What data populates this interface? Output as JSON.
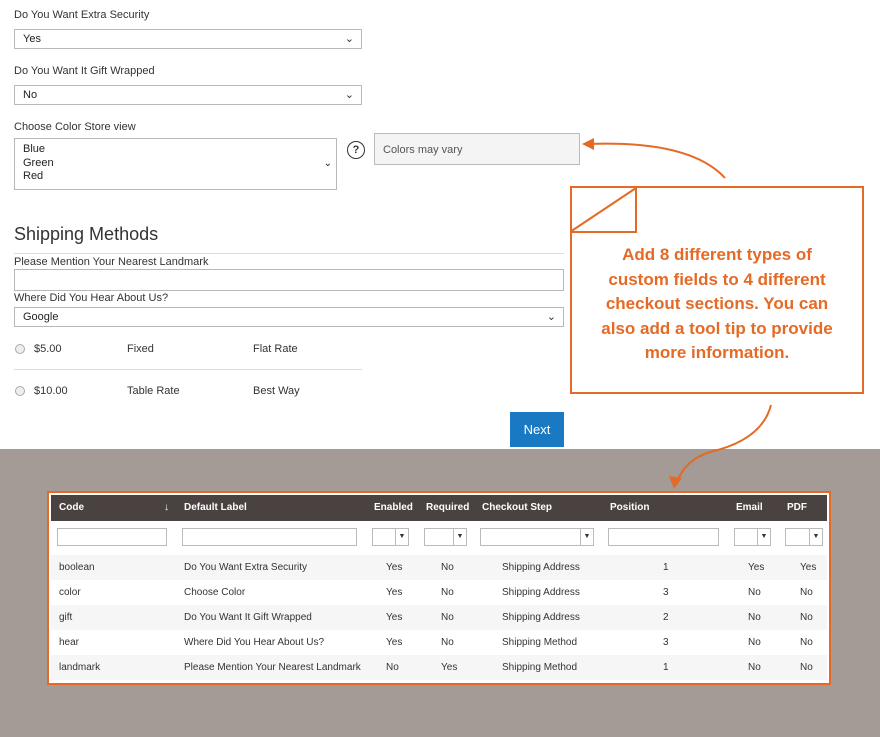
{
  "form": {
    "extra_security": {
      "label": "Do You Want Extra Security",
      "value": "Yes"
    },
    "gift_wrapped": {
      "label": "Do You Want It Gift Wrapped",
      "value": "No"
    },
    "color_store": {
      "label": "Choose Color Store view",
      "options": [
        "Blue",
        "Green",
        "Red"
      ],
      "help": "?",
      "tooltip": "Colors may vary"
    }
  },
  "shipping": {
    "title": "Shipping Methods",
    "landmark_label": "Please Mention Your Nearest Landmark",
    "landmark_value": "",
    "hear_label": "Where Did You Hear About Us?",
    "hear_value": "Google",
    "methods": [
      {
        "price": "$5.00",
        "type": "Fixed",
        "name": "Flat Rate"
      },
      {
        "price": "$10.00",
        "type": "Table Rate",
        "name": "Best Way"
      }
    ],
    "next_label": "Next"
  },
  "callout": {
    "lines": [
      "Add 8 different types of",
      "custom fields to 4 different",
      "checkout sections. You can",
      "also add a tool tip to provide",
      "more information."
    ],
    "color": "#e46a25"
  },
  "grid": {
    "columns": [
      "Code",
      "Default Label",
      "Enabled",
      "Required",
      "Checkout Step",
      "Position",
      "Email",
      "PDF"
    ],
    "sort_indicator": "↓",
    "rows": [
      [
        "boolean",
        "Do You Want Extra Security",
        "Yes",
        "No",
        "Shipping Address",
        "1",
        "Yes",
        "Yes"
      ],
      [
        "color",
        "Choose Color",
        "Yes",
        "No",
        "Shipping Address",
        "3",
        "No",
        "No"
      ],
      [
        "gift",
        "Do You Want It Gift Wrapped",
        "Yes",
        "No",
        "Shipping Address",
        "2",
        "No",
        "No"
      ],
      [
        "hear",
        "Where Did You Hear About Us?",
        "Yes",
        "No",
        "Shipping Method",
        "3",
        "No",
        "No"
      ],
      [
        "landmark",
        "Please Mention Your Nearest Landmark",
        "No",
        "Yes",
        "Shipping Method",
        "1",
        "No",
        "No"
      ]
    ]
  },
  "colors": {
    "accent": "#e46a25",
    "primary_button": "#1979c3",
    "grid_header": "#4a4240",
    "background_bottom": "#a49a96"
  },
  "icons": [
    "chevron-down-icon",
    "help-icon",
    "sort-arrow-icon",
    "radio-icon"
  ]
}
